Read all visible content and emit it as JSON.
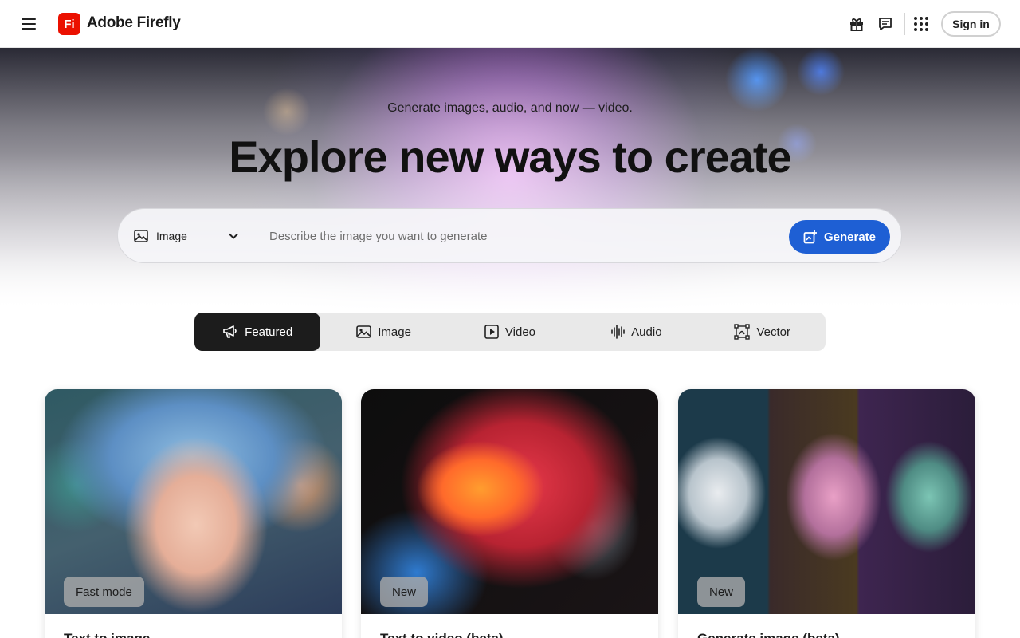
{
  "header": {
    "logo_text": "Fi",
    "brand": "Adobe Firefly",
    "icons": [
      "menu-icon",
      "gift-icon",
      "feedback-icon",
      "apps-grid-icon"
    ],
    "sign_in_label": "Sign in"
  },
  "hero": {
    "subtitle": "Generate images, audio, and now — video.",
    "title": "Explore new ways to create",
    "mode_select": {
      "value": "Image",
      "icon": "image-icon"
    },
    "prompt_placeholder": "Describe the image you want to generate",
    "generate_label": "Generate"
  },
  "tabs": [
    {
      "label": "Featured",
      "icon": "megaphone-icon",
      "active": true
    },
    {
      "label": "Image",
      "icon": "image-icon",
      "active": false
    },
    {
      "label": "Video",
      "icon": "video-icon",
      "active": false
    },
    {
      "label": "Audio",
      "icon": "audio-wave-icon",
      "active": false
    },
    {
      "label": "Vector",
      "icon": "vector-icon",
      "active": false
    }
  ],
  "cards": [
    {
      "badge": "Fast mode",
      "title": "Text to image"
    },
    {
      "badge": "New",
      "title": "Text to video (beta)"
    },
    {
      "badge": "New",
      "title": "Generate image (beta)"
    }
  ],
  "colors": {
    "brand_red": "#eb1000",
    "generate_blue": "#1e5fd4",
    "active_tab": "#1c1c1c",
    "tab_bar_bg": "#e9e9e9"
  }
}
